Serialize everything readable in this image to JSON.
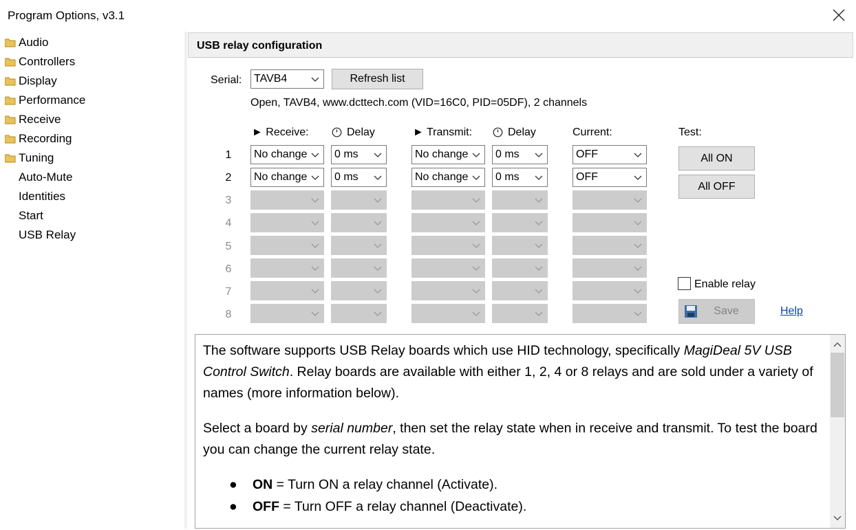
{
  "window": {
    "title": "Program Options, v3.1"
  },
  "sidebar": {
    "items": [
      {
        "label": "Audio",
        "folder": true
      },
      {
        "label": "Controllers",
        "folder": true
      },
      {
        "label": "Display",
        "folder": true
      },
      {
        "label": "Performance",
        "folder": true
      },
      {
        "label": "Receive",
        "folder": true
      },
      {
        "label": "Recording",
        "folder": true
      },
      {
        "label": "Tuning",
        "folder": true
      },
      {
        "label": "Auto-Mute",
        "folder": false
      },
      {
        "label": "Identities",
        "folder": false
      },
      {
        "label": "Start",
        "folder": false
      },
      {
        "label": "USB Relay",
        "folder": false
      }
    ]
  },
  "section": {
    "title": "USB relay configuration"
  },
  "serial": {
    "label": "Serial:",
    "value": "TAVB4",
    "refresh_label": "Refresh list",
    "info": "Open, TAVB4, www.dcttech.com (VID=16C0, PID=05DF), 2 channels"
  },
  "headers": {
    "receive": "► Receive:",
    "delay": "Delay",
    "transmit": "► Transmit:",
    "current": "Current:",
    "test": "Test:"
  },
  "rows": [
    {
      "num": "1",
      "receive": "No change",
      "rdelay": "0 ms",
      "transmit": "No change",
      "tdelay": "0 ms",
      "current": "OFF"
    },
    {
      "num": "2",
      "receive": "No change",
      "rdelay": "0 ms",
      "transmit": "No change",
      "tdelay": "0 ms",
      "current": "OFF"
    },
    {
      "num": "3"
    },
    {
      "num": "4"
    },
    {
      "num": "5"
    },
    {
      "num": "6"
    },
    {
      "num": "7"
    },
    {
      "num": "8"
    }
  ],
  "test": {
    "all_on": "All ON",
    "all_off": "All OFF"
  },
  "enable_relay": {
    "label": "Enable relay",
    "checked": false
  },
  "save_label": "Save",
  "help_label": "Help",
  "help_text": {
    "p1_a": "The software supports USB Relay boards which use HID technology, specifically ",
    "p1_em": "MagiDeal 5V USB Control Switch",
    "p1_b": ". Relay boards are available with either 1, 2, 4 or 8 relays and are sold under a variety of names (more information below).",
    "p2_a": "Select a board by ",
    "p2_em": "serial number",
    "p2_b": ", then set the relay state when in receive and transmit. To test the board you can change the current relay state.",
    "bullets": [
      {
        "bold": "ON",
        "rest": " = Turn ON a relay channel (Activate)."
      },
      {
        "bold": "OFF",
        "rest": " = Turn OFF a relay channel (Deactivate)."
      }
    ]
  }
}
